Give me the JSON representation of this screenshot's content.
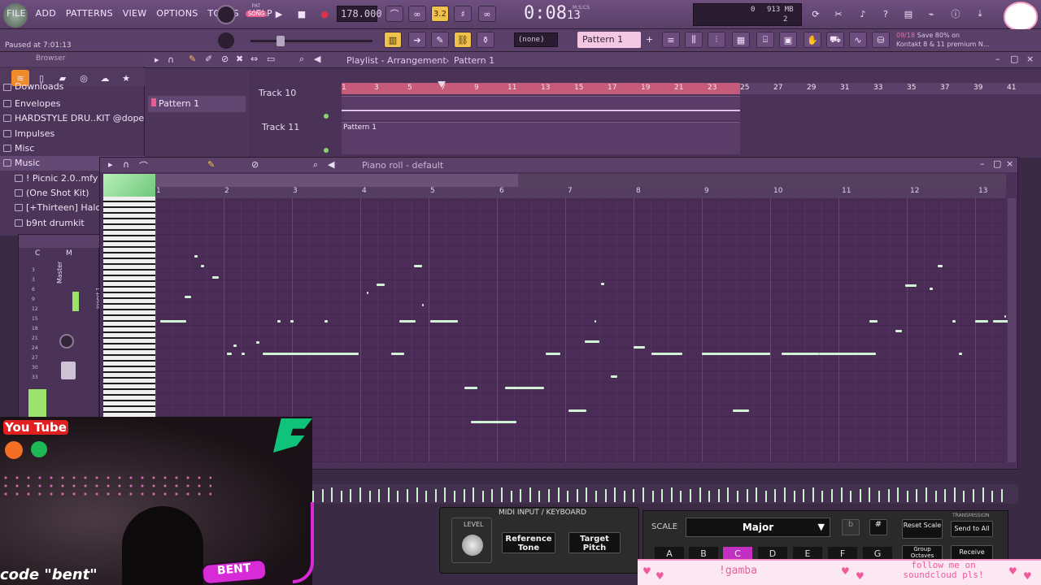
{
  "menubar": {
    "items": [
      "FILE",
      "ADD",
      "PATTERNS",
      "VIEW",
      "OPTIONS",
      "TOOLS",
      "HELP"
    ],
    "status": "Paused at 7:01:13",
    "pat_label": "PAT",
    "song_label": "SONG",
    "tempo": "178.000",
    "time": "0:08",
    "time_sub": "13",
    "time_unit": "M:S:CS",
    "memory": "913 MB",
    "mem_count": "2",
    "mem_zero": "0",
    "hint_count": "09/18",
    "hint_text": "Save 80% on",
    "hint_text2": "Kontakt 8 & 11 premium N...",
    "snap_value": "3.2",
    "pattern_name": "Pattern 1",
    "none_label": "(none)"
  },
  "browser": {
    "title": "Browser",
    "items": [
      "Downloads",
      "Envelopes",
      "HARDSTYLE DRU..KIT @dopekit",
      "Impulses",
      "Misc",
      "Music",
      "! Picnic 2.0..mfy",
      "(One Shot Kit)",
      "[+Thirteen] Halo",
      "b9nt drumkit"
    ]
  },
  "playlist": {
    "title": "Playlist - Arrangement",
    "pattern": "Pattern 1",
    "picker_item": "Pattern 1",
    "track10": "Track 10",
    "track11": "Track 11",
    "clip_label": "Pattern 1",
    "ruler_a": [
      "1",
      "3",
      "5",
      "7",
      "9",
      "11",
      "13",
      "15",
      "17",
      "19",
      "21",
      "23"
    ],
    "ruler_b": [
      "25",
      "27",
      "29",
      "31",
      "33",
      "35",
      "37",
      "39",
      "41"
    ]
  },
  "piano_roll": {
    "title": "Piano roll - default",
    "bars": [
      "1",
      "2",
      "3",
      "4",
      "5",
      "6",
      "7",
      "8",
      "9",
      "10",
      "11",
      "12",
      "13"
    ]
  },
  "mixer": {
    "master_label": "Master",
    "insert_label": "Insert 1",
    "c_label": "C",
    "m_label": "M",
    "scale": [
      "3",
      "3",
      "6",
      "9",
      "12",
      "15",
      "18",
      "21",
      "24",
      "27",
      "30",
      "33"
    ]
  },
  "midi_panel": {
    "header": "MIDI INPUT / KEYBOARD",
    "level": "LEVEL",
    "ref_tone": "Reference Tone",
    "target_pitch": "Target Pitch"
  },
  "scale_panel": {
    "scale_label": "SCALE",
    "scale_value": "Major",
    "flat": "b",
    "sharp": "#",
    "reset": "Reset Scale",
    "transmission": "TRANSMISSION",
    "send_all": "Send to All",
    "group": "Group Octaves",
    "receive": "Receive",
    "keys": [
      "A",
      "B",
      "C",
      "D",
      "E",
      "F",
      "G"
    ],
    "active_key": "C"
  },
  "stream": {
    "youtube": "You Tube",
    "code_text": "code \"bent\"",
    "banner_left": "!gamba",
    "banner_right": "follow me on soundcloud pls!",
    "sticker": "BENT"
  },
  "colors": {
    "accent": "#c65a7a",
    "note": "#d3f3d6",
    "panel": "#5a3f69",
    "active_key": "#c32fc3"
  }
}
